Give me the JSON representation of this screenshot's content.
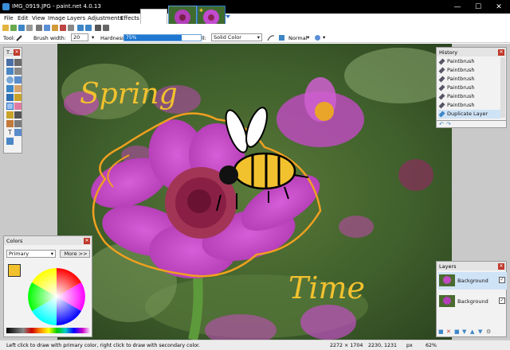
{
  "window": {
    "title": "IMG_0919.JPG - paint.net 4.0.13",
    "minimize_glyph": "—",
    "maximize_glyph": "☐",
    "close_glyph": "✕"
  },
  "menu": [
    "File",
    "Edit",
    "View",
    "Image",
    "Layers",
    "Adjustments",
    "Effects"
  ],
  "toolbar": {
    "tool_label": "Tool:",
    "brush_width_label": "Brush width:",
    "brush_width_value": "20",
    "hardness_label": "Hardness:",
    "hardness_value": "75%",
    "hardness_fraction": 0.75,
    "fill_label": "Fill:",
    "fill_value": "Solid Color",
    "blend_value": "Normal"
  },
  "tools_panel": {
    "title": "T..."
  },
  "history_panel": {
    "title": "History",
    "items": [
      "Paintbrush",
      "Paintbrush",
      "Paintbrush",
      "Paintbrush",
      "Paintbrush",
      "Paintbrush",
      "Duplicate Layer"
    ]
  },
  "layers_panel": {
    "title": "Layers",
    "layers": [
      {
        "name": "Background",
        "checked": "✓"
      },
      {
        "name": "Background",
        "checked": "✓"
      }
    ]
  },
  "colors_panel": {
    "title": "Colors",
    "mode": "Primary",
    "more_button": "More >>"
  },
  "canvas": {
    "text_spring": "Spring",
    "text_time": "Time"
  },
  "status": {
    "hint": "Left click to draw with primary color, right click to draw with secondary color.",
    "image_size": "2272 × 1704",
    "cursor_pos": "2230, 1231",
    "units": "px",
    "zoom": "62%"
  },
  "colors": {
    "primary": "#f2c12e",
    "secondary": "#ffffff",
    "accent": "#1f78d1",
    "titlebar": "#000000",
    "close_red": "#c0392b"
  }
}
